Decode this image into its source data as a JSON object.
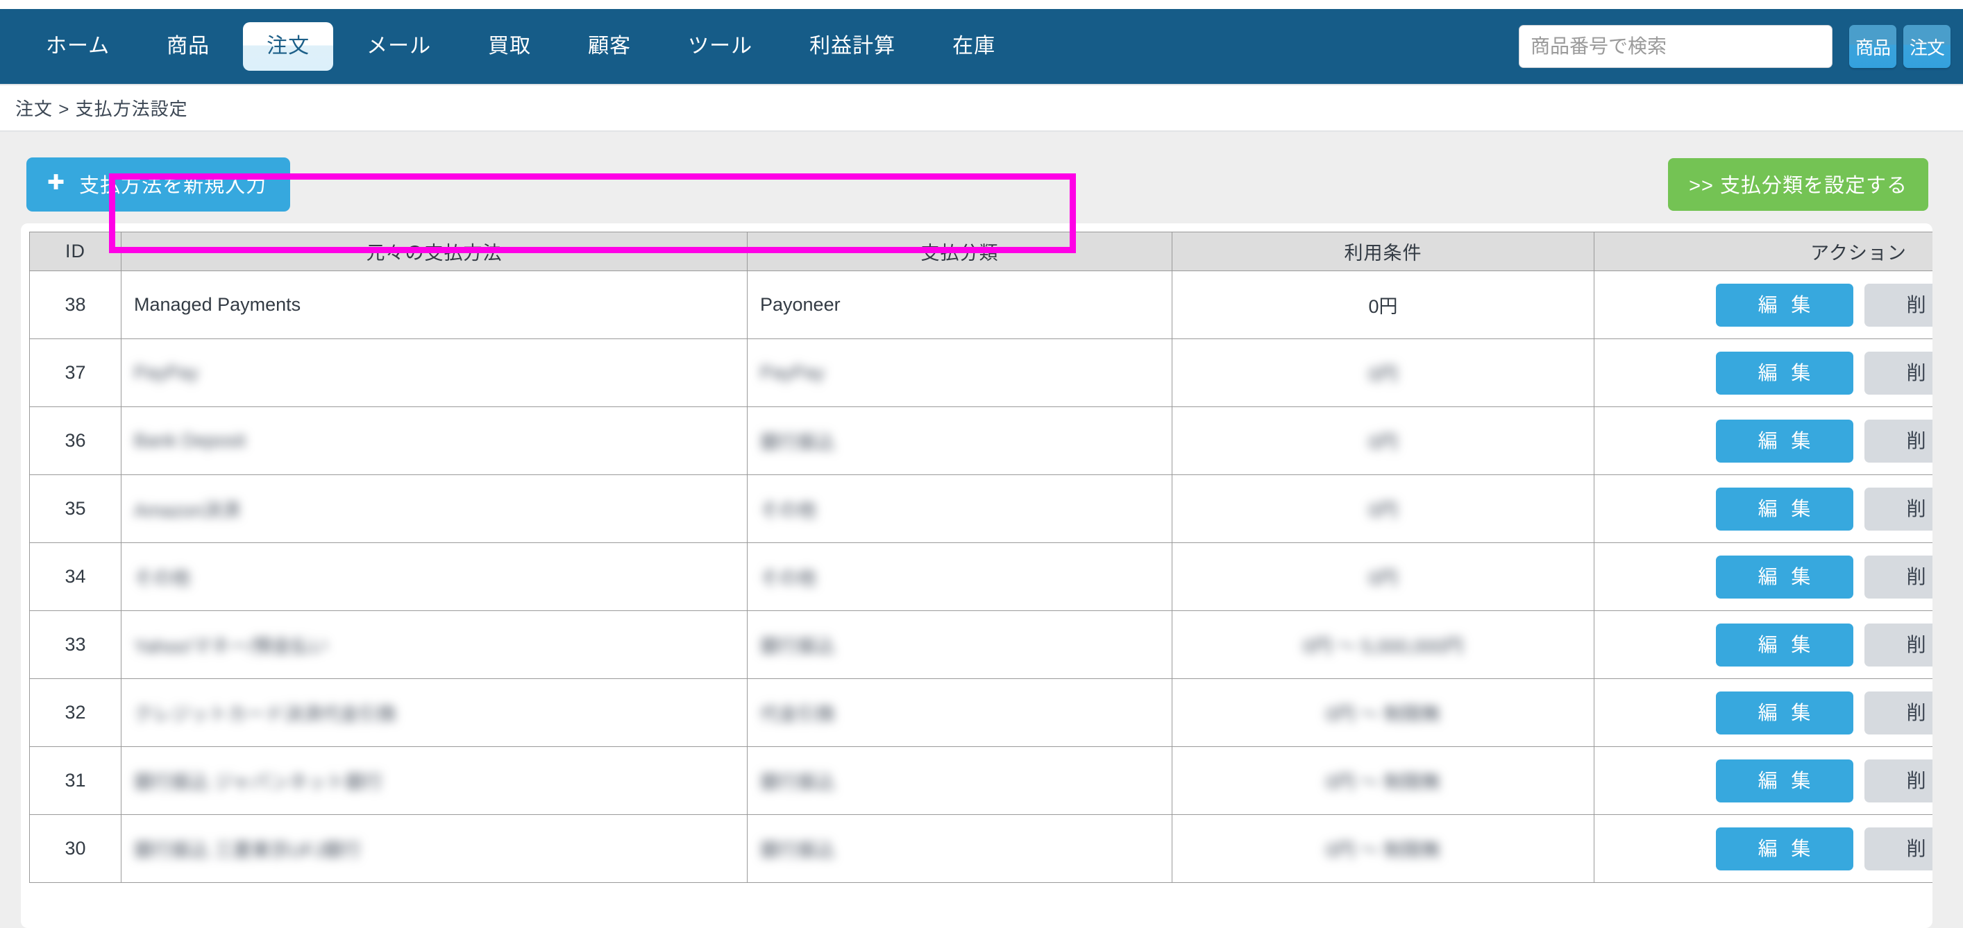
{
  "navbar": {
    "background_color": "#165C88",
    "items": [
      {
        "label": "ホーム",
        "active": false
      },
      {
        "label": "商品",
        "active": false
      },
      {
        "label": "注文",
        "active": true
      },
      {
        "label": "メール",
        "active": false
      },
      {
        "label": "買取",
        "active": false
      },
      {
        "label": "顧客",
        "active": false
      },
      {
        "label": "ツール",
        "active": false
      },
      {
        "label": "利益計算",
        "active": false
      },
      {
        "label": "在庫",
        "active": false
      }
    ],
    "search": {
      "placeholder": "商品番号で検索",
      "value": "",
      "buttons": [
        {
          "label": "商品"
        },
        {
          "label": "注文"
        }
      ]
    }
  },
  "breadcrumb": {
    "text": "注文 > 支払方法設定",
    "parts": [
      "注文",
      ">",
      "支払方法設定"
    ]
  },
  "toolbar": {
    "new_payment_label": "支払方法を新規入力",
    "new_payment_icon": "plus-icon",
    "new_payment_color": "#36A8DE",
    "set_category_label": ">> 支払分類を設定する",
    "set_category_color": "#74C354"
  },
  "table": {
    "columns": [
      "ID",
      "元々の支払方法",
      "支払分類",
      "利用条件",
      "アクション"
    ],
    "action_labels": {
      "edit": "編 集",
      "delete": "削 除"
    },
    "action_colors": {
      "edit": "#37A8DE",
      "delete": "#D6DADF"
    },
    "rows": [
      {
        "id": "38",
        "method": "Managed Payments",
        "category": "Payoneer",
        "condition": "0円",
        "redacted": false,
        "highlighted": true
      },
      {
        "id": "37",
        "method": "PayPay",
        "category": "PayPay",
        "condition": "0円",
        "redacted": true,
        "highlighted": false
      },
      {
        "id": "36",
        "method": "Bank Deposit",
        "category": "銀行振込",
        "condition": "0円",
        "redacted": true,
        "highlighted": false
      },
      {
        "id": "35",
        "method": "Amazon決済",
        "category": "その他",
        "condition": "0円",
        "redacted": true,
        "highlighted": false
      },
      {
        "id": "34",
        "method": "その他",
        "category": "その他",
        "condition": "0円",
        "redacted": true,
        "highlighted": false
      },
      {
        "id": "33",
        "method": "Yahoo!マネー/預金払い",
        "category": "銀行振込",
        "condition": "0円 〜 5,000,000円",
        "redacted": true,
        "highlighted": false
      },
      {
        "id": "32",
        "method": "クレジットカード決済代金引換",
        "category": "代金引換",
        "condition": "0円 〜 制限無",
        "redacted": true,
        "highlighted": false
      },
      {
        "id": "31",
        "method": "銀行振込 ジャパンネット銀行",
        "category": "銀行振込",
        "condition": "0円 〜 制限無",
        "redacted": true,
        "highlighted": false
      },
      {
        "id": "30",
        "method": "銀行振込 三菱東京UFJ銀行",
        "category": "銀行振込",
        "condition": "0円 〜 制限無",
        "redacted": true,
        "highlighted": false
      }
    ]
  },
  "highlight": {
    "color": "#FF00E6",
    "target_row_id": "38",
    "covers_columns": [
      "元々の支払方法",
      "支払分類"
    ]
  }
}
